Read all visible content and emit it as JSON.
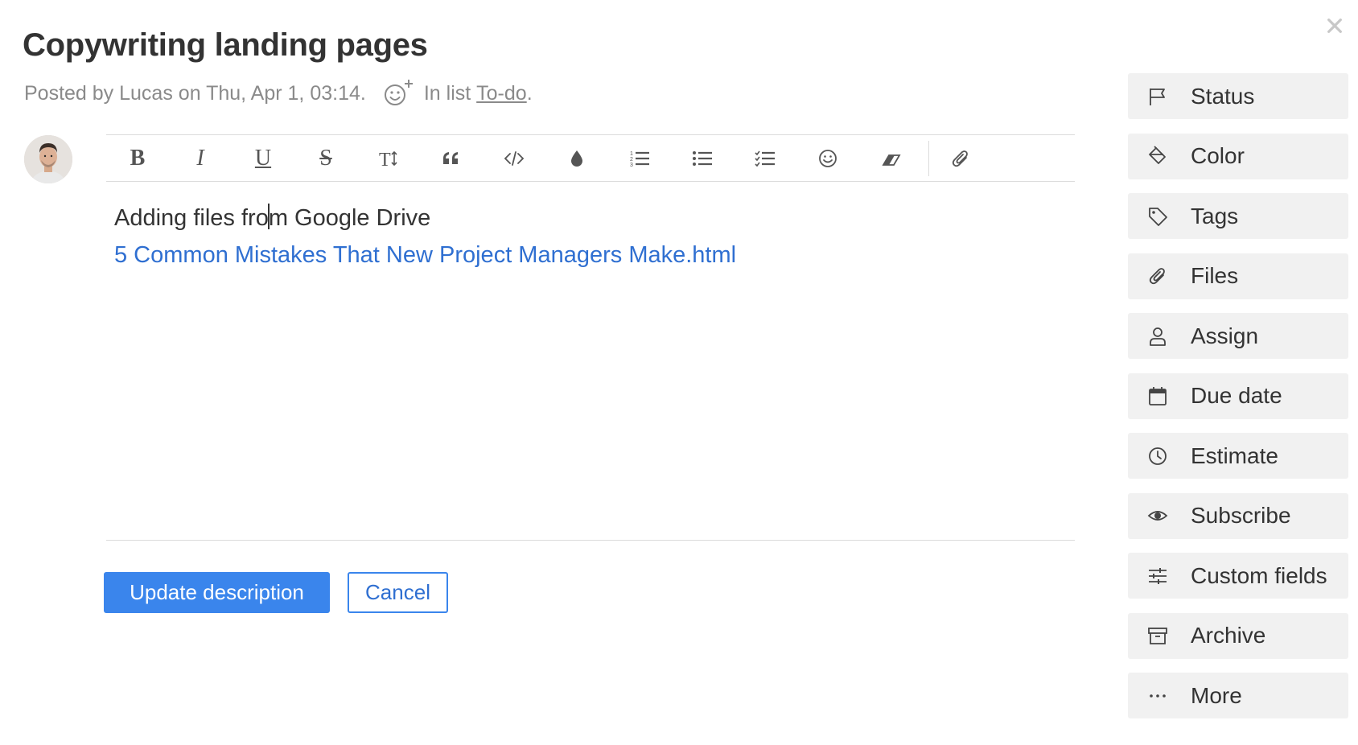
{
  "card": {
    "title": "Copywriting landing pages",
    "meta_prefix": "Posted by Lucas on Thu, Apr 1, 03:14.",
    "list_prefix": "In list",
    "list_name": "To-do",
    "list_suffix": "."
  },
  "editor": {
    "toolbar": [
      {
        "name": "bold-button",
        "icon": "bold-icon"
      },
      {
        "name": "italic-button",
        "icon": "italic-icon"
      },
      {
        "name": "underline-button",
        "icon": "underline-icon"
      },
      {
        "name": "strikethrough-button",
        "icon": "strikethrough-icon"
      },
      {
        "name": "text-size-button",
        "icon": "text-size-icon"
      },
      {
        "name": "quote-button",
        "icon": "quote-icon"
      },
      {
        "name": "code-button",
        "icon": "code-icon"
      },
      {
        "name": "text-color-button",
        "icon": "droplet-icon"
      },
      {
        "name": "numbered-list-button",
        "icon": "numbered-list-icon"
      },
      {
        "name": "bullet-list-button",
        "icon": "bullet-list-icon"
      },
      {
        "name": "checklist-button",
        "icon": "checklist-icon"
      },
      {
        "name": "emoji-button",
        "icon": "smiley-icon"
      },
      {
        "name": "clear-format-button",
        "icon": "eraser-icon"
      },
      {
        "name": "attach-button",
        "icon": "paperclip-icon"
      }
    ],
    "line1_before_caret": "Adding files fro",
    "line1_after_caret": "m Google Drive",
    "link_text": "5 Common Mistakes That New Project Managers Make.html"
  },
  "actions": {
    "update_label": "Update description",
    "cancel_label": "Cancel"
  },
  "sidebar": {
    "items": [
      {
        "label": "Status",
        "icon": "flag-icon"
      },
      {
        "label": "Color",
        "icon": "paint-bucket-icon"
      },
      {
        "label": "Tags",
        "icon": "tag-icon"
      },
      {
        "label": "Files",
        "icon": "paperclip-icon"
      },
      {
        "label": "Assign",
        "icon": "user-icon"
      },
      {
        "label": "Due date",
        "icon": "calendar-icon"
      },
      {
        "label": "Estimate",
        "icon": "clock-icon"
      },
      {
        "label": "Subscribe",
        "icon": "eye-icon"
      },
      {
        "label": "Custom fields",
        "icon": "sliders-icon"
      },
      {
        "label": "Archive",
        "icon": "archive-icon"
      },
      {
        "label": "More",
        "icon": "more-icon"
      }
    ]
  },
  "colors": {
    "accent": "#3a85ec",
    "link": "#2f6fd1",
    "sidebar_bg": "#f1f1f1"
  }
}
